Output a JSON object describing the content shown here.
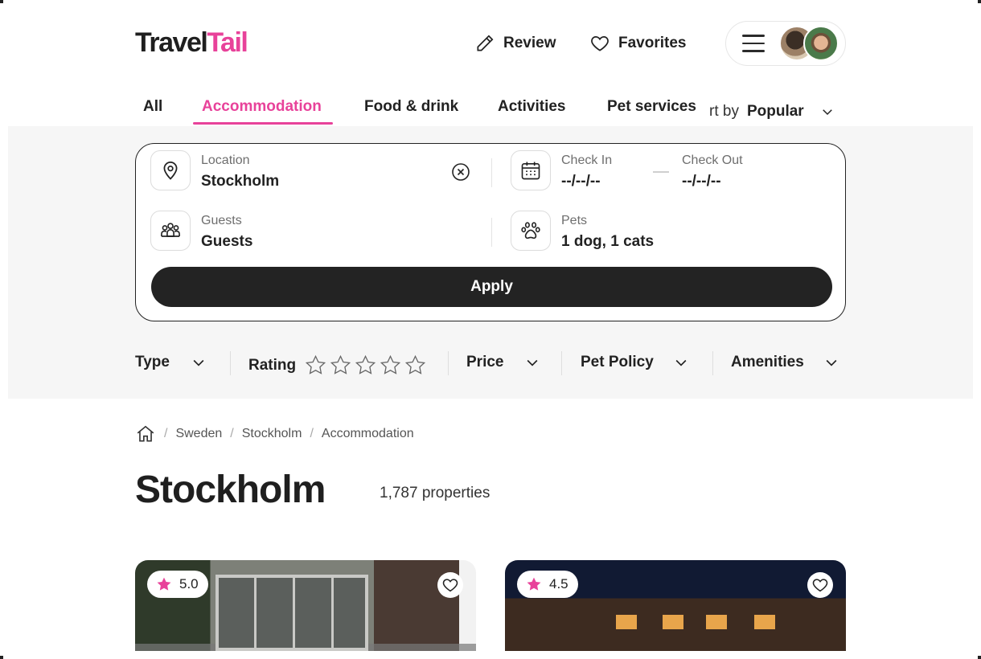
{
  "header": {
    "logo_part1": "Travel",
    "logo_part2": "Tail",
    "review_label": "Review",
    "favorites_label": "Favorites"
  },
  "tabs": [
    {
      "label": "All",
      "active": false
    },
    {
      "label": "Accommodation",
      "active": true
    },
    {
      "label": "Food & drink",
      "active": false
    },
    {
      "label": "Activities",
      "active": false
    },
    {
      "label": "Pet services",
      "active": false
    }
  ],
  "sort": {
    "label": "rt by",
    "value": "Popular"
  },
  "search": {
    "location_label": "Location",
    "location_value": "Stockholm",
    "checkin_label": "Check In",
    "checkin_value": "--/--/--",
    "checkout_label": "Check Out",
    "checkout_value": "--/--/--",
    "guests_label": "Guests",
    "guests_value": "Guests",
    "pets_label": "Pets",
    "pets_value": "1 dog, 1 cats",
    "apply_label": "Apply"
  },
  "filters": {
    "type_label": "Type",
    "rating_label": "Rating",
    "price_label": "Price",
    "pet_policy_label": "Pet Policy",
    "amenities_label": "Amenities"
  },
  "breadcrumb": {
    "items": [
      "Sweden",
      "Stockholm",
      "Accommodation"
    ],
    "separator": "/"
  },
  "page": {
    "title": "Stockholm",
    "count": "1,787 properties"
  },
  "results": [
    {
      "rating": "5.0"
    },
    {
      "rating": "4.5"
    }
  ],
  "colors": {
    "accent": "#e8429a",
    "dark": "#232323",
    "band": "#f6f6f6"
  }
}
